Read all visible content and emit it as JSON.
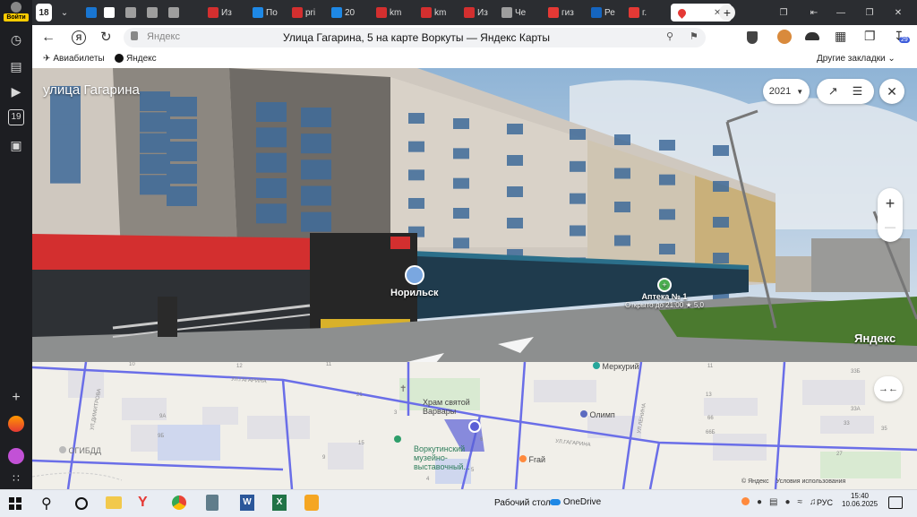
{
  "sidebar": {
    "login_label": "Войти",
    "badge_count": "19"
  },
  "tabs": {
    "count": "18",
    "items": [
      {
        "label": "",
        "icon": "edge-icon",
        "color": "#1976d2"
      },
      {
        "label": "",
        "icon": "page-icon",
        "color": "#ffffff"
      },
      {
        "label": "",
        "icon": "doc-icon",
        "color": "#9e9e9e"
      },
      {
        "label": "",
        "icon": "doc-icon",
        "color": "#9e9e9e"
      },
      {
        "label": "",
        "icon": "doc-icon",
        "color": "#9e9e9e"
      },
      {
        "label": "Из",
        "icon": "pdf-icon",
        "color": "#d32f2f"
      },
      {
        "label": "По",
        "icon": "mail-icon",
        "color": "#1e88e5"
      },
      {
        "label": "pri",
        "icon": "pdf-icon",
        "color": "#d32f2f"
      },
      {
        "label": "20",
        "icon": "doc-icon",
        "color": "#1e88e5"
      },
      {
        "label": "km",
        "icon": "pdf-icon",
        "color": "#d32f2f"
      },
      {
        "label": "km",
        "icon": "pdf-icon",
        "color": "#d32f2f"
      },
      {
        "label": "Из",
        "icon": "rtf-icon",
        "color": "#d32f2f"
      },
      {
        "label": "Че",
        "icon": "doc-icon",
        "color": "#9e9e9e"
      },
      {
        "label": "гиз",
        "icon": "search-icon",
        "color": "#e53935"
      },
      {
        "label": "Ре",
        "icon": "shield-icon",
        "color": "#1565c0"
      },
      {
        "label": "г. ",
        "icon": "search-icon",
        "color": "#e53935"
      }
    ],
    "active": {
      "label": "",
      "icon": "map-pin-icon"
    }
  },
  "toolbar": {
    "brand": "Яндекс",
    "page_title": "Улица Гагарина, 5 на карте Воркуты — Яндекс Карты",
    "downloads_badge": "29"
  },
  "bookmarks": {
    "items": [
      "Авиабилеты",
      "Яндекс"
    ],
    "other": "Другие закладки"
  },
  "panorama": {
    "street_title": "улица Гагарина",
    "year": "2021",
    "store_label": "Норильск",
    "pharmacy_name": "Аптека № 1",
    "pharmacy_hours": "Открыто до 21:00",
    "pharmacy_rating": "★ 5,0",
    "watermark": "Яндекс",
    "zoom_in": "+",
    "zoom_out": "—"
  },
  "map": {
    "labels": {
      "merkuriy": "Меркурий",
      "church": "Храм святой\nВарвары",
      "olimp": "Олимп",
      "museum": "Воркутинский\nмузейно-\nвыставочный...",
      "frai": "Fraй",
      "ogibdd": "ОГИБДД",
      "street_gagarina_1": "УЛ.ГАГАРИНА",
      "street_gagarina_2": "УЛ.ГАГАРИНА",
      "street_dimitrova": "УЛ.ДИМИТРОВА",
      "street_lenina": "УЛ.ЛЕНИНА"
    },
    "house_numbers": [
      "12",
      "10",
      "11",
      "21",
      "3",
      "9А",
      "9Б",
      "15",
      "9",
      "6",
      "11",
      "13",
      "33Б",
      "33А",
      "33",
      "35",
      "66",
      "66Б",
      "27",
      "4",
      "5"
    ],
    "copyright": "© Яндекс",
    "terms": "Условия использования"
  },
  "taskbar": {
    "desktop_label": "Рабочий стол",
    "onedrive_label": "OneDrive",
    "language": "РУС",
    "time": "15:40",
    "date": "10.06.2025"
  }
}
